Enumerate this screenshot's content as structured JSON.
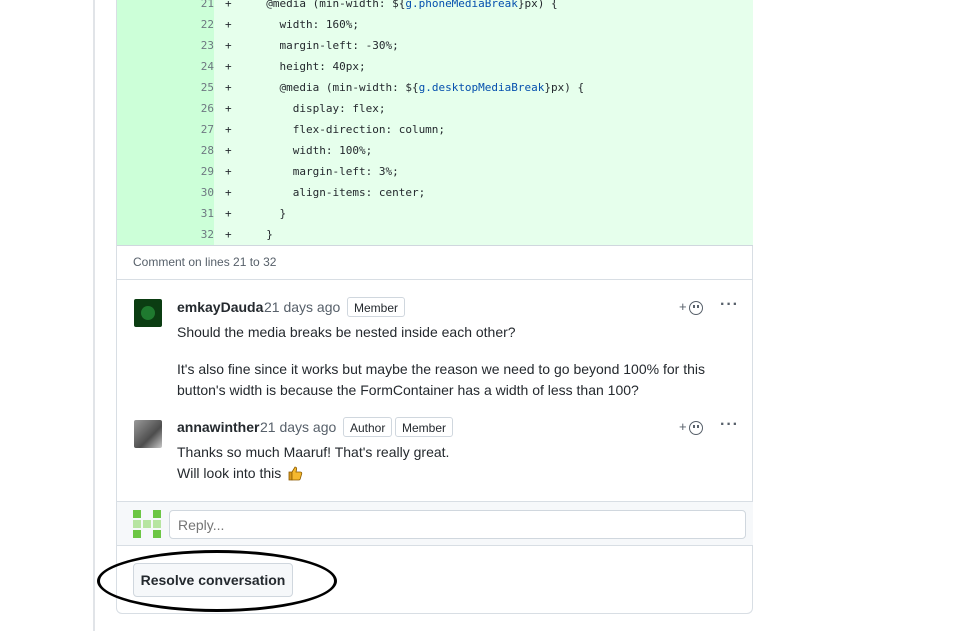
{
  "code": {
    "lines": [
      {
        "num": "21",
        "sign": "+",
        "pre": "  @media (min-width: ${",
        "var": "g.phoneMediaBreak",
        "post": "}px) {"
      },
      {
        "num": "22",
        "sign": "+",
        "pre": "    width: 160%;",
        "var": "",
        "post": ""
      },
      {
        "num": "23",
        "sign": "+",
        "pre": "    margin-left: -30%;",
        "var": "",
        "post": ""
      },
      {
        "num": "24",
        "sign": "+",
        "pre": "    height: 40px;",
        "var": "",
        "post": ""
      },
      {
        "num": "25",
        "sign": "+",
        "pre": "    @media (min-width: ${",
        "var": "g.desktopMediaBreak",
        "post": "}px) {"
      },
      {
        "num": "26",
        "sign": "+",
        "pre": "      display: flex;",
        "var": "",
        "post": ""
      },
      {
        "num": "27",
        "sign": "+",
        "pre": "      flex-direction: column;",
        "var": "",
        "post": ""
      },
      {
        "num": "28",
        "sign": "+",
        "pre": "      width: 100%;",
        "var": "",
        "post": ""
      },
      {
        "num": "29",
        "sign": "+",
        "pre": "      margin-left: 3%;",
        "var": "",
        "post": ""
      },
      {
        "num": "30",
        "sign": "+",
        "pre": "      align-items: center;",
        "var": "",
        "post": ""
      },
      {
        "num": "31",
        "sign": "+",
        "pre": "    }",
        "var": "",
        "post": ""
      },
      {
        "num": "32",
        "sign": "+",
        "pre": "  }",
        "var": "",
        "post": ""
      }
    ]
  },
  "comment_lines": "Comment on lines 21 to 32",
  "comments": [
    {
      "author": "emkayDauda",
      "time": "21 days ago",
      "badges": [
        "Member"
      ],
      "paragraphs": [
        "Should the media breaks be nested inside each other?",
        "It's also fine since it works but maybe the reason we need to go beyond 100% for this",
        "button's width is because the FormContainer has a width of less than 100?"
      ]
    },
    {
      "author": "annawinther",
      "time": "21 days ago",
      "badges": [
        "Author",
        "Member"
      ],
      "paragraphs": [
        "Thanks so much Maaruf! That's really great.",
        "Will look into this"
      ]
    }
  ],
  "reaction_plus": "+",
  "more_glyph": "···",
  "reply": {
    "placeholder": "Reply..."
  },
  "resolve_label": "Resolve conversation",
  "colors": {
    "added_bg": "#e6ffec",
    "added_num_bg": "#ccffd8",
    "accent_var": "#0550ae"
  },
  "icons": [
    "smiley-icon",
    "kebab-icon",
    "thumbs-up-icon"
  ]
}
